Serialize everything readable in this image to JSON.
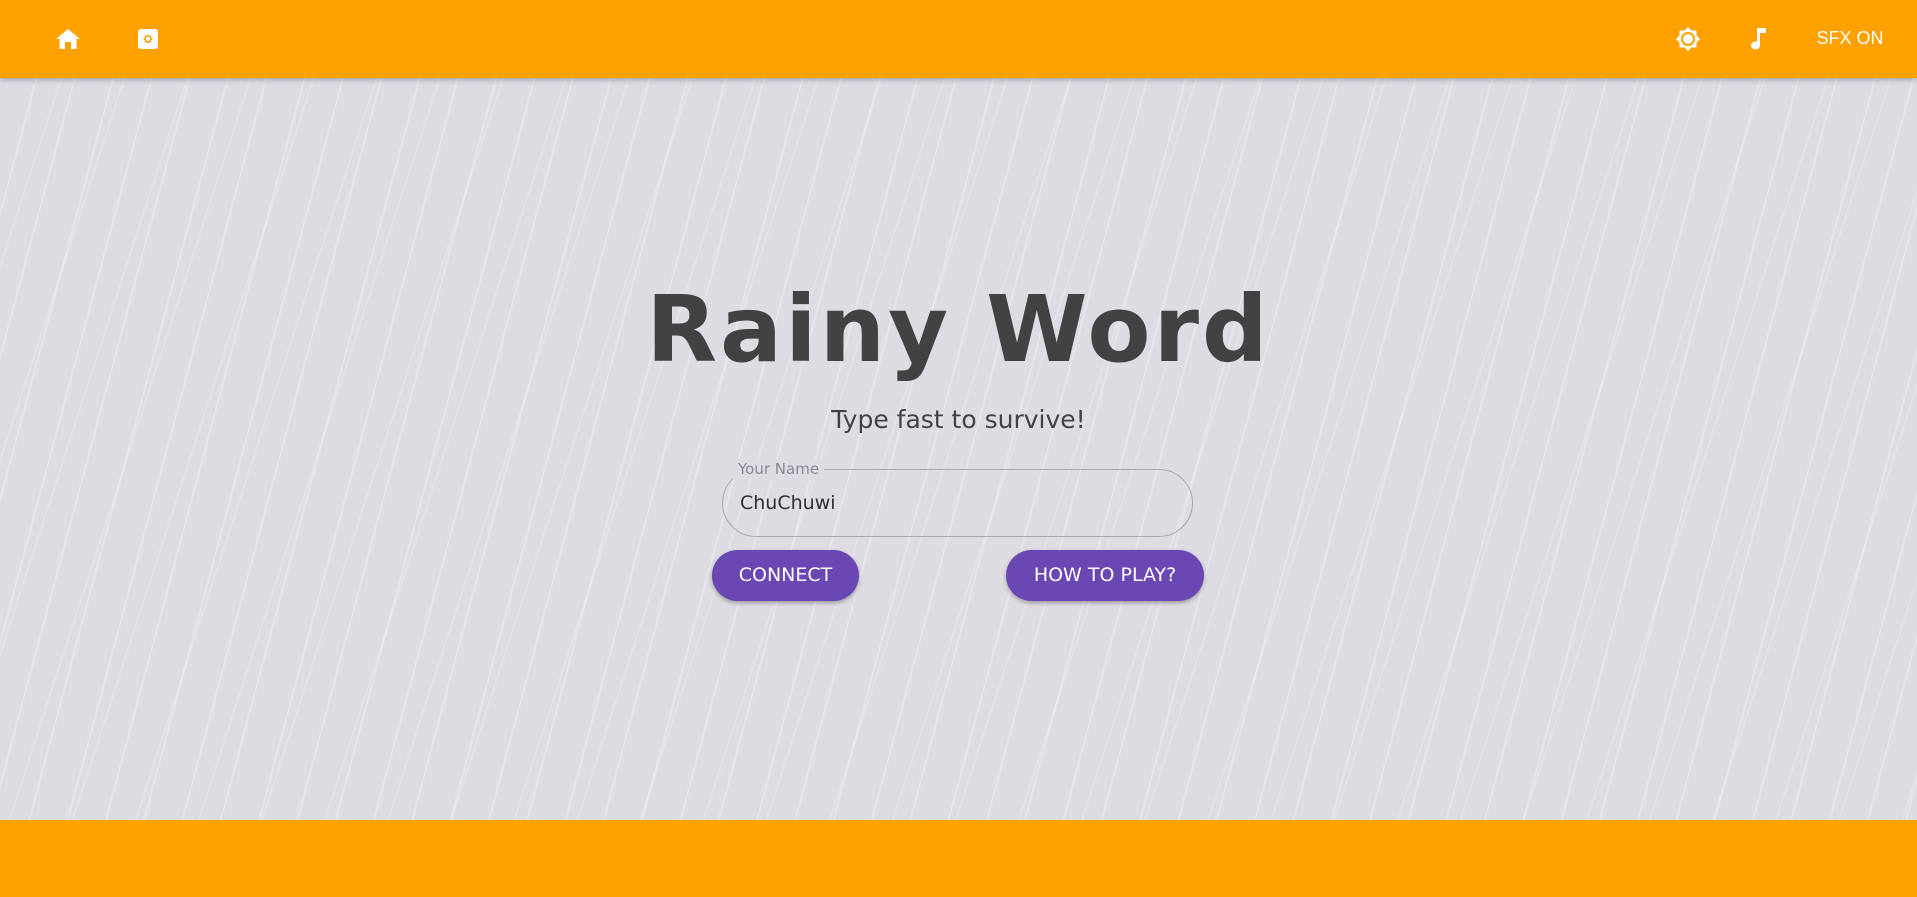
{
  "header": {
    "home_icon": "home-icon",
    "game_icon": "gamepad-icon",
    "theme_icon": "brightness-icon",
    "music_icon": "music-note-icon",
    "sfx_label": "SFX ON"
  },
  "main": {
    "title": "Rainy Word",
    "subtitle": "Type fast to survive!",
    "name_field": {
      "label": "Your Name",
      "value": "ChuChuwi"
    },
    "connect_label": "CONNECT",
    "howto_label": "HOW TO PLAY?"
  },
  "colors": {
    "bar": "#ffa200",
    "background": "#dedce3",
    "button": "#6a47b3",
    "text": "#424242"
  }
}
